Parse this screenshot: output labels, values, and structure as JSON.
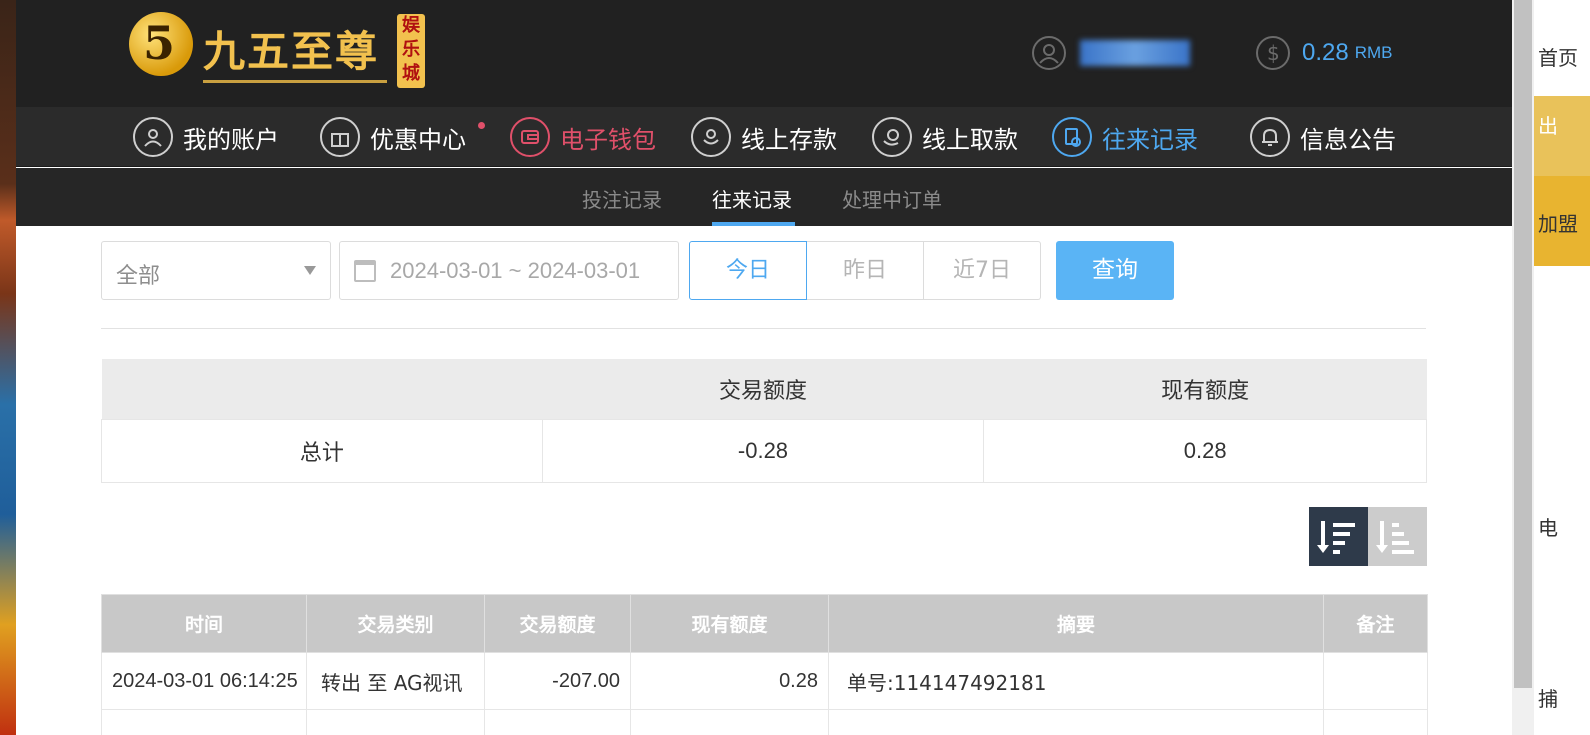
{
  "brand": {
    "badge": "5",
    "name": "九五至尊",
    "tag": "娱乐城"
  },
  "header": {
    "balance": "0.28",
    "currency": "RMB"
  },
  "main_nav": [
    {
      "label": "我的账户",
      "icon": "user-icon"
    },
    {
      "label": "优惠中心",
      "icon": "gift-icon"
    },
    {
      "label": "电子钱包",
      "icon": "wallet-icon"
    },
    {
      "label": "线上存款",
      "icon": "deposit-icon"
    },
    {
      "label": "线上取款",
      "icon": "withdraw-icon"
    },
    {
      "label": "往来记录",
      "icon": "records-icon"
    },
    {
      "label": "信息公告",
      "icon": "bell-icon"
    }
  ],
  "sub_nav": [
    {
      "label": "投注记录"
    },
    {
      "label": "往来记录"
    },
    {
      "label": "处理中订单"
    }
  ],
  "filters": {
    "type_value": "全部",
    "date_range": "2024-03-01 ~ 2024-03-01",
    "quick": [
      "今日",
      "昨日",
      "近7日"
    ],
    "search_label": "查询"
  },
  "summary": {
    "headers": [
      "",
      "交易额度",
      "现有额度"
    ],
    "row": {
      "label": "总计",
      "amount": "-0.28",
      "balance": "0.28"
    }
  },
  "records": {
    "headers": [
      "时间",
      "交易类别",
      "交易额度",
      "现有额度",
      "摘要",
      "备注"
    ],
    "rows": [
      {
        "time": "2024-03-01 06:14:25",
        "type": "转出 至 AG视讯",
        "amount": "-207.00",
        "balance": "0.28",
        "memo": "单号:114147492181",
        "note": ""
      }
    ]
  },
  "background_page": {
    "right_texts": [
      "首页",
      "出",
      "加盟",
      "电",
      "捕"
    ]
  },
  "colors": {
    "accent_blue": "#4ea8f0",
    "accent_red": "#e0506a",
    "header_bg": "#212121",
    "search_button": "#5ab4f5"
  }
}
